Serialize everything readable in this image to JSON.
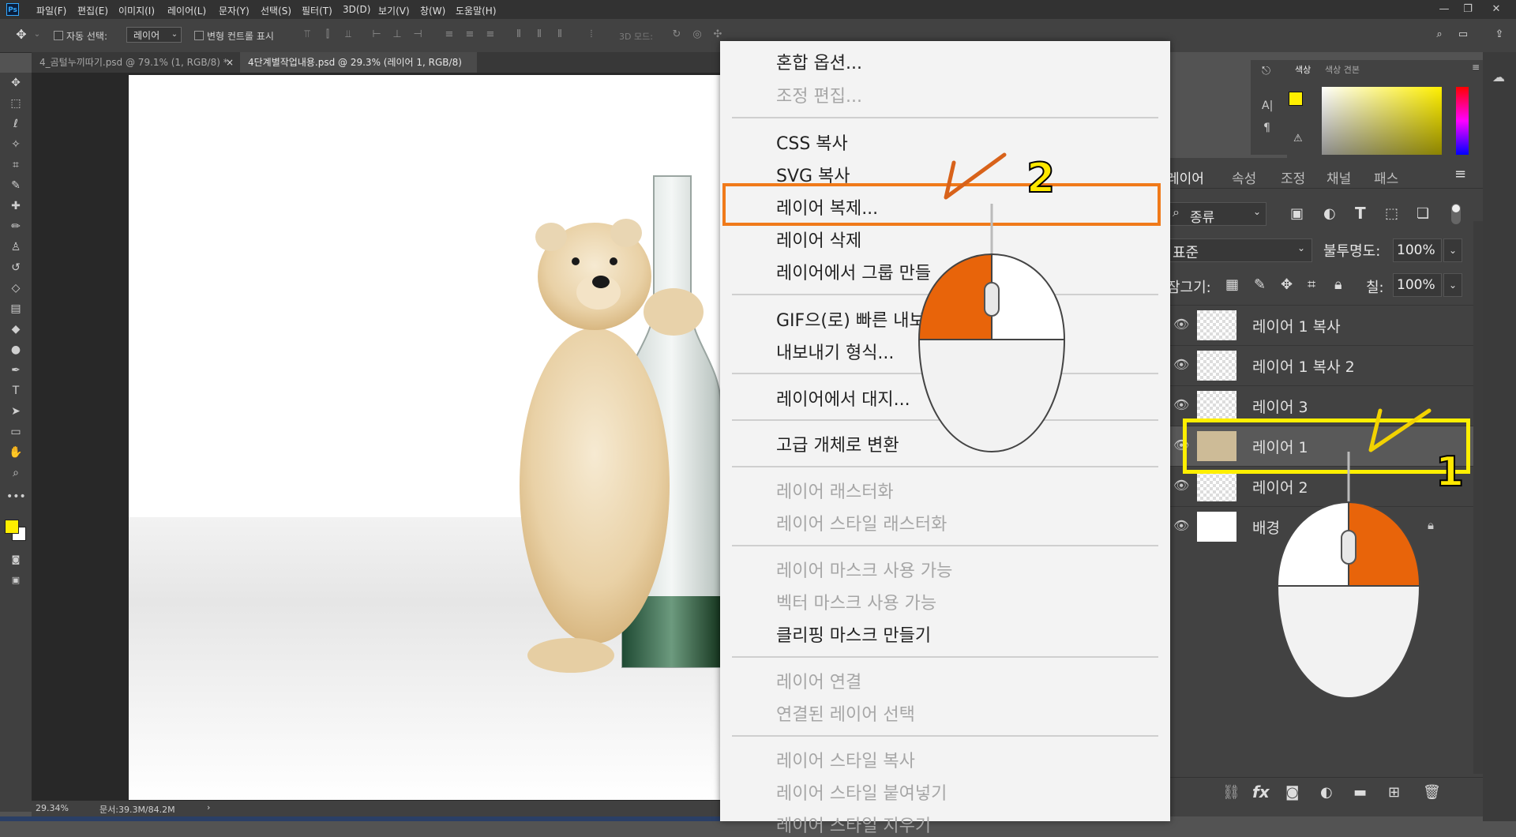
{
  "app": {
    "logo": "Ps"
  },
  "menubar": [
    "파일(F)",
    "편집(E)",
    "이미지(I)",
    "레이어(L)",
    "문자(Y)",
    "선택(S)",
    "필터(T)",
    "3D(D)",
    "보기(V)",
    "창(W)",
    "도움말(H)"
  ],
  "window_controls": {
    "minimize": "—",
    "restore": "❐",
    "close": "✕"
  },
  "options": {
    "auto_select_label": "자동 선택:",
    "auto_select_value": "레이어",
    "transform_controls_label": "변형 컨트롤 표시",
    "mode_3d_label": "3D 모드:"
  },
  "tabs": [
    {
      "label": "4_곰털누끼따기.psd @ 79.1% (1, RGB/8) *",
      "close": "×"
    },
    {
      "label": "4단계별작업내용.psd @ 29.3% (레이어 1, RGB/8) *",
      "close": "×"
    }
  ],
  "status": {
    "zoom": "29.34%",
    "doc": "문서:39.3M/84.2M",
    "arrow": "›"
  },
  "context_menu": {
    "groups": [
      [
        {
          "label": "혼합 옵션...",
          "enabled": true
        },
        {
          "label": "조정 편집...",
          "enabled": false
        }
      ],
      [
        {
          "label": "CSS 복사",
          "enabled": true
        },
        {
          "label": "SVG 복사",
          "enabled": true
        },
        {
          "label": "레이어 복제...",
          "enabled": true
        },
        {
          "label": "레이어 삭제",
          "enabled": true
        },
        {
          "label": "레이어에서 그룹 만들",
          "enabled": true
        }
      ],
      [
        {
          "label": "GIF으(로) 빠른 내보",
          "enabled": true
        },
        {
          "label": "내보내기 형식...",
          "enabled": true
        }
      ],
      [
        {
          "label": "레이어에서 대지...",
          "enabled": true
        }
      ],
      [
        {
          "label": "고급 개체로 변환",
          "enabled": true
        }
      ],
      [
        {
          "label": "레이어 래스터화",
          "enabled": false
        },
        {
          "label": "레이어 스타일 래스터화",
          "enabled": false
        }
      ],
      [
        {
          "label": "레이어 마스크 사용 가능",
          "enabled": false
        },
        {
          "label": "벡터 마스크 사용 가능",
          "enabled": false
        },
        {
          "label": "클리핑 마스크 만들기",
          "enabled": true
        }
      ],
      [
        {
          "label": "레이어 연결",
          "enabled": false
        },
        {
          "label": "연결된 레이어 선택",
          "enabled": false
        }
      ],
      [
        {
          "label": "레이어 스타일 복사",
          "enabled": false
        },
        {
          "label": "레이어 스타일 붙여넣기",
          "enabled": false
        },
        {
          "label": "레이어 스타일 지우기",
          "enabled": false
        }
      ]
    ]
  },
  "color_panel": {
    "tabs": [
      "색상",
      "색상 견본"
    ],
    "foreground": "#ffef00",
    "background": "#ffffff"
  },
  "layers_panel": {
    "tabs": [
      "레이어",
      "속성",
      "조정",
      "채널",
      "패스"
    ],
    "filter_label": "종류",
    "blend_mode": "표준",
    "opacity_label": "불투명도:",
    "opacity_value": "100%",
    "lock_label": "잠그기:",
    "fill_label": "칠:",
    "fill_value": "100%",
    "layers": [
      {
        "name": "레이어 1 복사",
        "selected": false
      },
      {
        "name": "레이어 1 복사 2",
        "selected": false
      },
      {
        "name": "레이어 3",
        "selected": false
      },
      {
        "name": "레이어 1",
        "selected": true
      },
      {
        "name": "레이어 2",
        "selected": false
      },
      {
        "name": "배경",
        "selected": false
      }
    ]
  },
  "annotations": {
    "step1": "1",
    "step2": "2",
    "highlight_orange": "#f07a1a",
    "highlight_yellow": "#ffef00",
    "mouse_accent": "#e8640a"
  }
}
